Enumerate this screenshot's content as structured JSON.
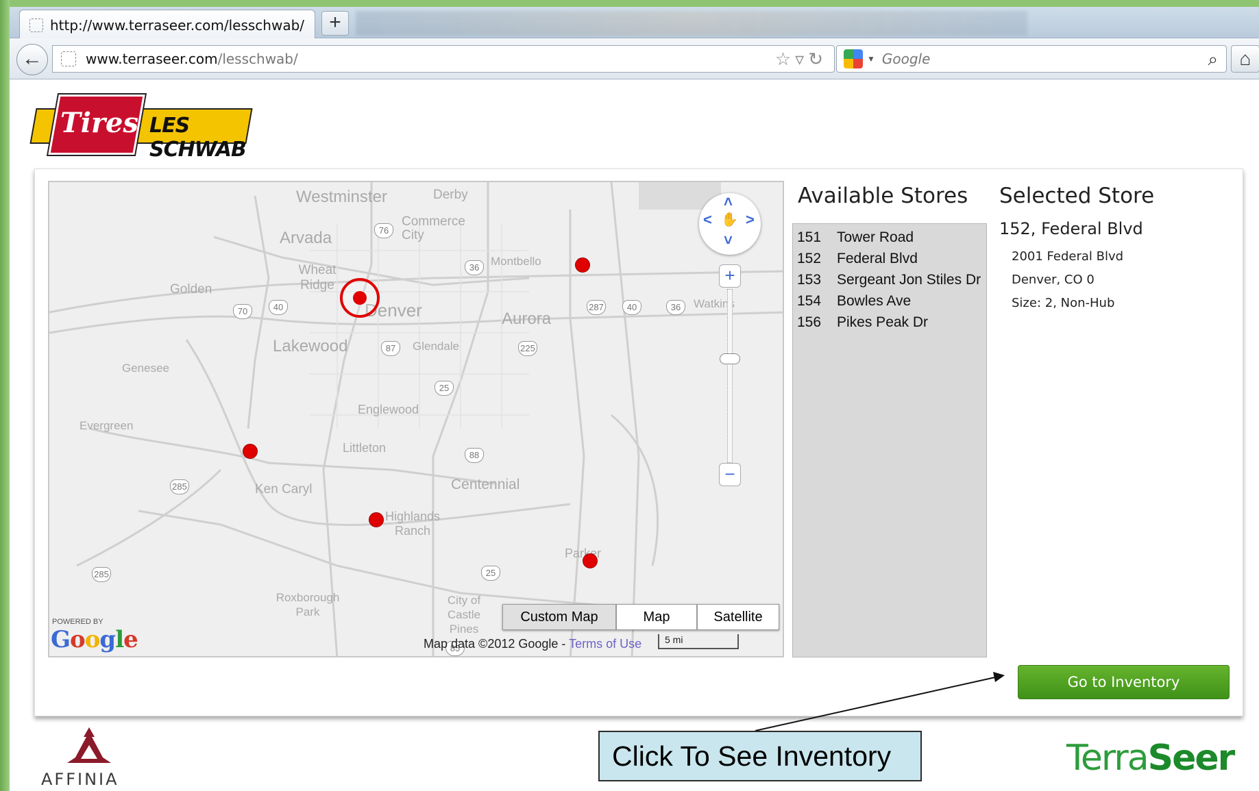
{
  "browser": {
    "tab_title": "http://www.terraseer.com/lesschwab/",
    "new_tab_symbol": "+",
    "url_domain": "www.terraseer.com",
    "url_path": "/lesschwab/",
    "search_placeholder": "Google"
  },
  "logo": {
    "left_text": "Tires",
    "right_text": "LES SCHWAB"
  },
  "map": {
    "place_labels": [
      "Westminster",
      "Derby",
      "Commerce City",
      "Arvada",
      "Montbello",
      "Wheat Ridge",
      "Golden",
      "Denver",
      "Aurora",
      "Lakewood",
      "Glendale",
      "Genesee",
      "Englewood",
      "Evergreen",
      "Littleton",
      "Ken Caryl",
      "Centennial",
      "Highlands Ranch",
      "Parker",
      "Roxborough Park",
      "City of Castle Pines",
      "Watkins"
    ],
    "highway_labels": [
      "76",
      "36",
      "70",
      "40",
      "287",
      "40",
      "36",
      "87",
      "225",
      "25",
      "88",
      "285",
      "285",
      "25",
      "85"
    ],
    "zoom_in": "+",
    "zoom_out": "−",
    "map_types": [
      "Custom Map",
      "Map",
      "Satellite"
    ],
    "active_map_type": "Custom Map",
    "attribution": "Map data ©2012  Google - ",
    "terms_link": "Terms of Use",
    "scale_label": "5 mi",
    "powered_by": "POWERED BY",
    "google_logo": "Google"
  },
  "stores": {
    "title": "Available Stores",
    "items": [
      {
        "num": "151",
        "name": "Tower Road"
      },
      {
        "num": "152",
        "name": "Federal Blvd"
      },
      {
        "num": "153",
        "name": "Sergeant Jon Stiles Dr"
      },
      {
        "num": "154",
        "name": "Bowles Ave"
      },
      {
        "num": "156",
        "name": "Pikes Peak Dr"
      }
    ]
  },
  "selected": {
    "title": "Selected Store",
    "name": "152, Federal Blvd",
    "address": "2001 Federal Blvd",
    "city": "Denver, CO 0",
    "size": "Size: 2, Non-Hub"
  },
  "inventory_button": "Go to Inventory",
  "callout": "Click To See Inventory",
  "footer": {
    "affinia": "AFFINIA",
    "terraseer_1": "Terra",
    "terraseer_2": "Seer"
  },
  "colors": {
    "pin": "#e00000",
    "button_green": "#4fa220",
    "callout_bg": "#c9e6ee",
    "affinia_red": "#8b1a2b"
  }
}
